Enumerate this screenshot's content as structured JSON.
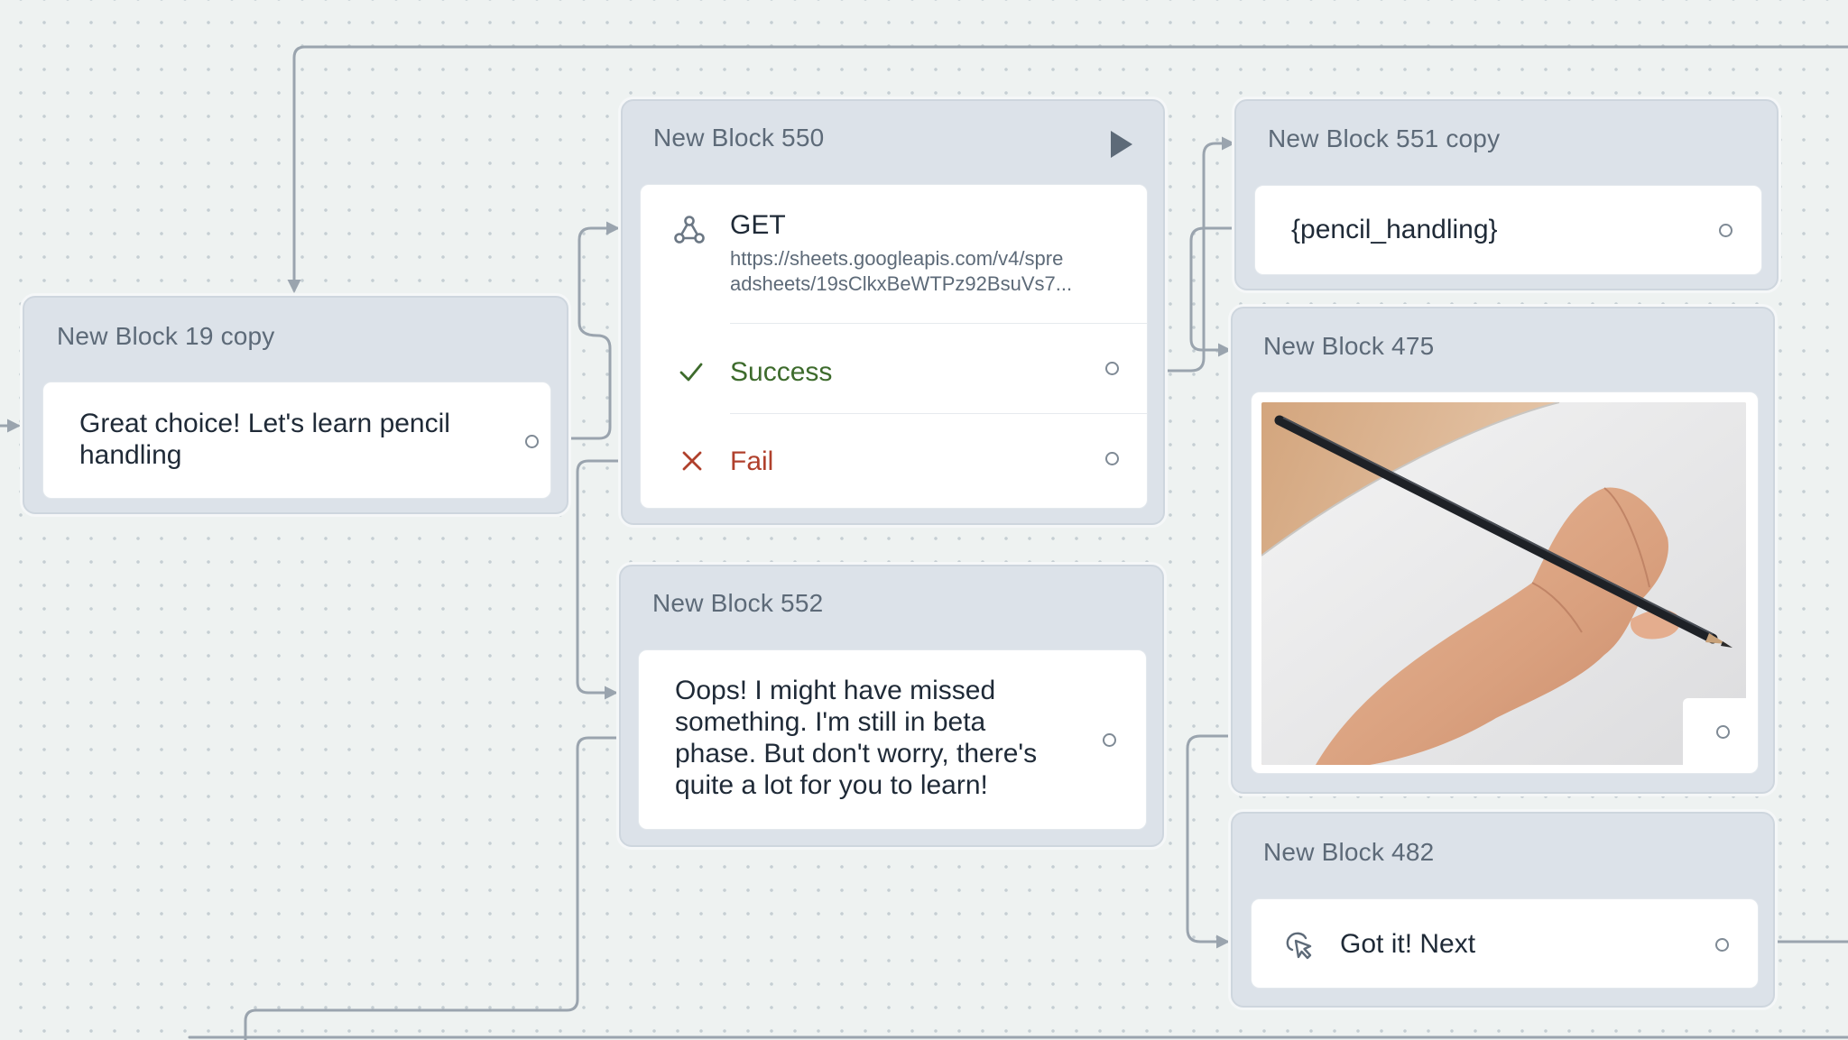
{
  "blocks": {
    "b19": {
      "title": "New Block 19 copy",
      "text_line1": "Great choice! Let's learn pencil",
      "text_line2": "handling"
    },
    "b550": {
      "title": "New Block 550",
      "method": "GET",
      "url_line1": "https://sheets.googleapis.com/v4/spre",
      "url_line2": "adsheets/19sClkxBeWTPz92BsuVs7...",
      "success_label": "Success",
      "fail_label": "Fail"
    },
    "b552": {
      "title": "New Block 552",
      "text_line1": "Oops! I might have missed",
      "text_line2": "something. I'm still in beta",
      "text_line3": "phase. But don't worry, there's",
      "text_line4": "quite a lot for you to learn!"
    },
    "b551": {
      "title": "New Block 551 copy",
      "text": "{pencil_handling}"
    },
    "b475": {
      "title": "New Block 475"
    },
    "b482": {
      "title": "New Block 482",
      "button_label": "Got it! Next"
    }
  },
  "icons": {
    "play": "play-icon",
    "webhook": "webhook-icon",
    "success": "check-icon",
    "fail": "close-icon",
    "button": "pointer-click-icon"
  },
  "colors": {
    "canvas_bg": "#eef2f1",
    "block_bg": "#dce2e9",
    "edge": "#9aa4ae",
    "success": "#3d6b2c",
    "fail": "#b0402c",
    "title": "#5d6a78"
  }
}
